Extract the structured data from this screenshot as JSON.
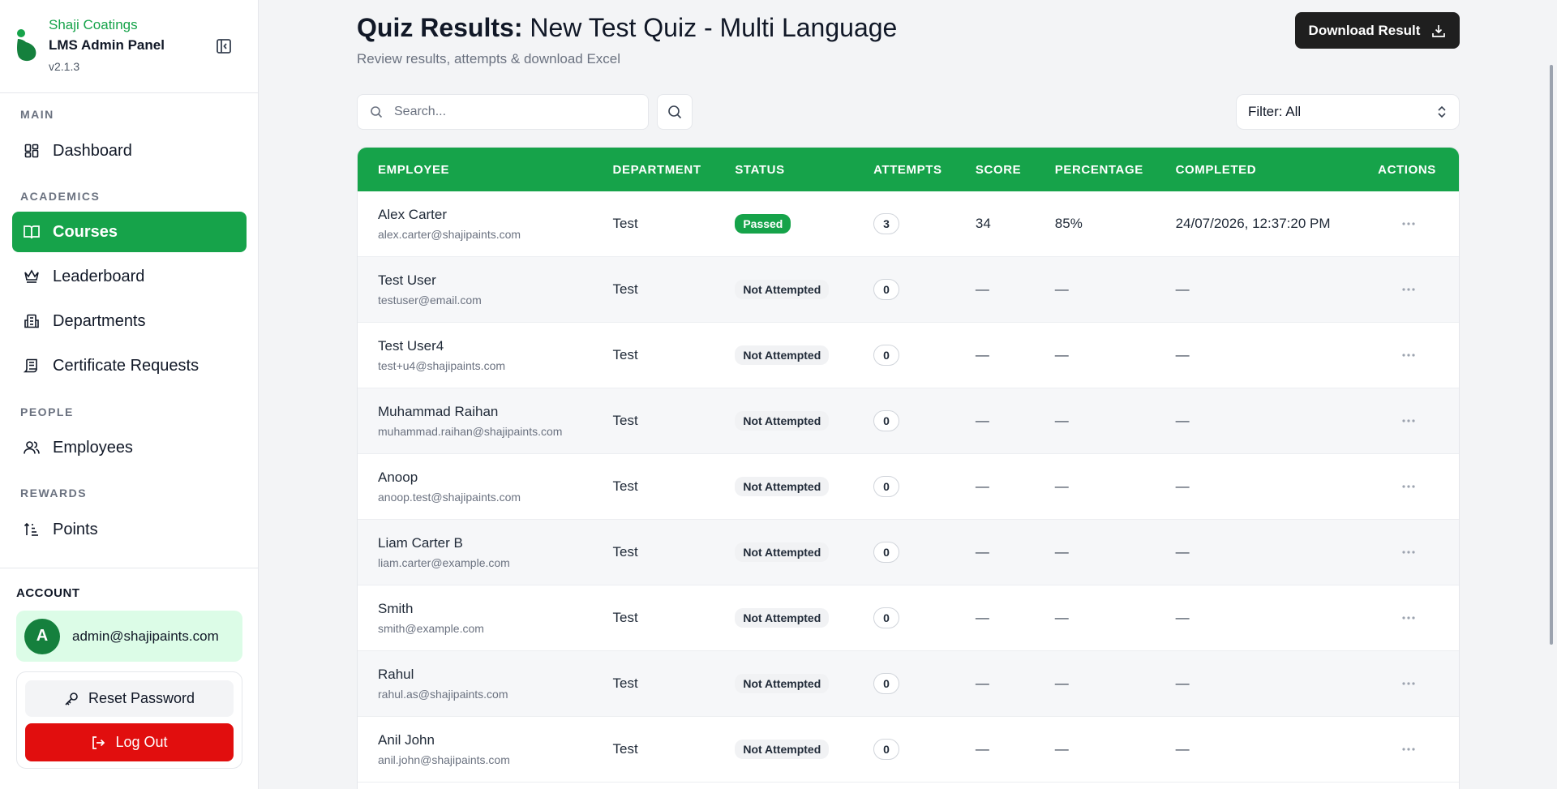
{
  "brand": {
    "company": "Shaji Coatings",
    "title": "LMS Admin Panel",
    "version": "v2.1.3",
    "accent": "#16a34a"
  },
  "sidebar": {
    "sections": {
      "main": "MAIN",
      "academics": "ACADEMICS",
      "people": "PEOPLE",
      "rewards": "REWARDS"
    },
    "items": [
      {
        "label": "Dashboard",
        "icon": "dashboard-icon"
      },
      {
        "label": "Courses",
        "icon": "book-icon",
        "active": true
      },
      {
        "label": "Leaderboard",
        "icon": "crown-icon"
      },
      {
        "label": "Departments",
        "icon": "building-icon"
      },
      {
        "label": "Certificate Requests",
        "icon": "certificate-icon"
      },
      {
        "label": "Employees",
        "icon": "users-icon"
      },
      {
        "label": "Points",
        "icon": "sort-icon"
      }
    ],
    "account": {
      "label": "ACCOUNT",
      "avatar_letter": "A",
      "email": "admin@shajipaints.com",
      "reset_label": "Reset Password",
      "logout_label": "Log Out"
    }
  },
  "header": {
    "title_prefix": "Quiz Results:",
    "title_name": "New Test Quiz - Multi Language",
    "subtitle": "Review results, attempts & download Excel",
    "download_label": "Download Result"
  },
  "toolbar": {
    "search_placeholder": "Search...",
    "filter_label": "Filter: All"
  },
  "table": {
    "columns": [
      "EMPLOYEE",
      "DEPARTMENT",
      "STATUS",
      "ATTEMPTS",
      "SCORE",
      "PERCENTAGE",
      "COMPLETED",
      "ACTIONS"
    ],
    "rows": [
      {
        "name": "Alex Carter",
        "email": "alex.carter@shajipaints.com",
        "department": "Test",
        "status": "Passed",
        "attempts": "3",
        "score": "34",
        "percentage": "85%",
        "completed": "24/07/2026, 12:37:20 PM"
      },
      {
        "name": "Test User",
        "email": "testuser@email.com",
        "department": "Test",
        "status": "Not Attempted",
        "attempts": "0",
        "score": "—",
        "percentage": "—",
        "completed": "—"
      },
      {
        "name": "Test User4",
        "email": "test+u4@shajipaints.com",
        "department": "Test",
        "status": "Not Attempted",
        "attempts": "0",
        "score": "—",
        "percentage": "—",
        "completed": "—"
      },
      {
        "name": "Muhammad Raihan",
        "email": "muhammad.raihan@shajipaints.com",
        "department": "Test",
        "status": "Not Attempted",
        "attempts": "0",
        "score": "—",
        "percentage": "—",
        "completed": "—"
      },
      {
        "name": "Anoop",
        "email": "anoop.test@shajipaints.com",
        "department": "Test",
        "status": "Not Attempted",
        "attempts": "0",
        "score": "—",
        "percentage": "—",
        "completed": "—"
      },
      {
        "name": "Liam Carter B",
        "email": "liam.carter@example.com",
        "department": "Test",
        "status": "Not Attempted",
        "attempts": "0",
        "score": "—",
        "percentage": "—",
        "completed": "—"
      },
      {
        "name": "Smith",
        "email": "smith@example.com",
        "department": "Test",
        "status": "Not Attempted",
        "attempts": "0",
        "score": "—",
        "percentage": "—",
        "completed": "—"
      },
      {
        "name": "Rahul",
        "email": "rahul.as@shajipaints.com",
        "department": "Test",
        "status": "Not Attempted",
        "attempts": "0",
        "score": "—",
        "percentage": "—",
        "completed": "—"
      },
      {
        "name": "Anil John",
        "email": "anil.john@shajipaints.com",
        "department": "Test",
        "status": "Not Attempted",
        "attempts": "0",
        "score": "—",
        "percentage": "—",
        "completed": "—"
      }
    ]
  }
}
